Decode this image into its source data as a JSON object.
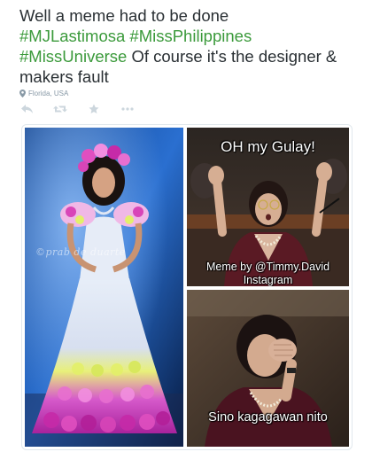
{
  "tweet": {
    "text_lead": "Well a meme had to be done",
    "hashtags": [
      "#MJLastimosa",
      "#MissPhilippines",
      "#MissUniverse"
    ],
    "text_tail": "Of course it's the designer & makers fault",
    "location": "Florida, USA"
  },
  "actions": {
    "icons": [
      "reply-icon",
      "retweet-icon",
      "favorite-icon",
      "more-icon"
    ]
  },
  "media": {
    "watermark": "©prab de duarte",
    "top_right": {
      "caption_top": "OH my Gulay!",
      "credit_line1": "Meme by @Timmy.David",
      "credit_line2": "Instagram"
    },
    "bottom_right": {
      "caption": "Sino kagagawan nito"
    }
  },
  "colors": {
    "hashtag": "#3b9a3b",
    "text": "#292f33",
    "meta": "#8899a6"
  }
}
